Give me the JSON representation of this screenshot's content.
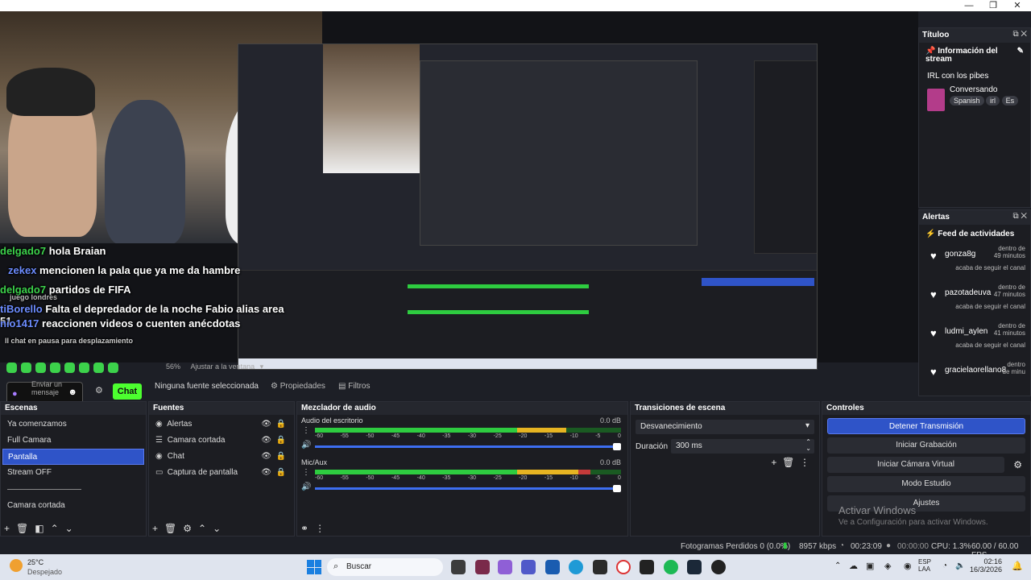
{
  "window": {
    "minimize": "—",
    "restore": "❐",
    "close": "✕"
  },
  "preview": {
    "chat_lines": [
      {
        "user": "delgado7",
        "message": "hola Braian"
      },
      {
        "user": "zekex",
        "message": "mencionen la pala que ya me da hambre"
      },
      {
        "user": "delgado7",
        "message": "partidos de FIFA"
      },
      {
        "user": "tiBorello",
        "message": "Falta el depredador de la noche Fabio alias area 51"
      },
      {
        "user": "nio1417",
        "message": "reaccionen videos o cuenten anécdotas"
      }
    ],
    "chat_faded": [
      "juego londres",
      "ll chat en pausa para desplazamiento"
    ],
    "chat_input_placeholder": "Enviar un mensaje",
    "chat_button": "Chat",
    "zoom_level": "56%",
    "fit_label": "Ajustar a la ventana",
    "no_source": "Ninguna fuente seleccionada",
    "properties": "Propiedades",
    "filters": "Filtros"
  },
  "title_dock": {
    "header": "Títuloo",
    "info_title": "Información del stream",
    "stream_title": "IRL con los pibes",
    "category": "Conversando",
    "tags": [
      "Spanish",
      "irl",
      "Es"
    ]
  },
  "alerts_dock": {
    "header": "Alertas",
    "feed_title": "Feed de actividades",
    "items": [
      {
        "user": "gonza8g",
        "time": "dentro de 49 minutos",
        "action": "acaba de seguir el canal"
      },
      {
        "user": "pazotadeuva",
        "time": "dentro de 47 minutos",
        "action": "acaba de seguir el canal"
      },
      {
        "user": "ludmi_aylen",
        "time": "dentro de 41 minutos",
        "action": "acaba de seguir el canal"
      },
      {
        "user": "gracielaorellano8",
        "time": "dentro de minu",
        "action": ""
      }
    ]
  },
  "scenes": {
    "header": "Escenas",
    "items": [
      "Ya comenzamos",
      "Full Camara",
      "Pantalla",
      "Stream OFF",
      "Camara cortada"
    ],
    "selected": "Pantalla"
  },
  "sources": {
    "header": "Fuentes",
    "items": [
      "Alertas",
      "Camara cortada",
      "Chat",
      "Captura de pantalla"
    ]
  },
  "mixer": {
    "header": "Mezclador de audio",
    "tracks": [
      {
        "name": "Audio del escritorio",
        "db": "0.0 dB",
        "level": 0.82
      },
      {
        "name": "Mic/Aux",
        "db": "0.0 dB",
        "level": 0.9
      }
    ],
    "scale": [
      "-60",
      "-55",
      "-50",
      "-45",
      "-40",
      "-35",
      "-30",
      "-25",
      "-20",
      "-15",
      "-10",
      "-5",
      "0"
    ]
  },
  "transitions": {
    "header": "Transiciones de escena",
    "transition": "Desvanecimiento",
    "duration_label": "Duración",
    "duration_value": "300 ms"
  },
  "controls": {
    "header": "Controles",
    "buttons": [
      "Detener Transmisión",
      "Iniciar Grabación",
      "Iniciar Cámara Virtual",
      "Modo Estudio",
      "Ajustes"
    ]
  },
  "watermark": {
    "title": "Activar Windows",
    "subtitle": "Ve a Configuración para activar Windows."
  },
  "status": {
    "dropped": "Fotogramas Perdidos 0 (0.0%)",
    "kbps": "8957 kbps",
    "live_time": "00:23:09",
    "rec_time": "00:00:00",
    "cpu": "CPU: 1.3%",
    "fps": "60.00 / 60.00 FPS"
  },
  "taskbar": {
    "weather_temp": "25°C",
    "weather_desc": "Despejado",
    "search": "Buscar",
    "lang": "ESP",
    "lang2": "LAA",
    "time": "02:16",
    "date": "16/3/2026"
  },
  "colors": {
    "accent": "#2f54c8",
    "chat_green": "#4cff2f",
    "username": "#3cd24b"
  }
}
